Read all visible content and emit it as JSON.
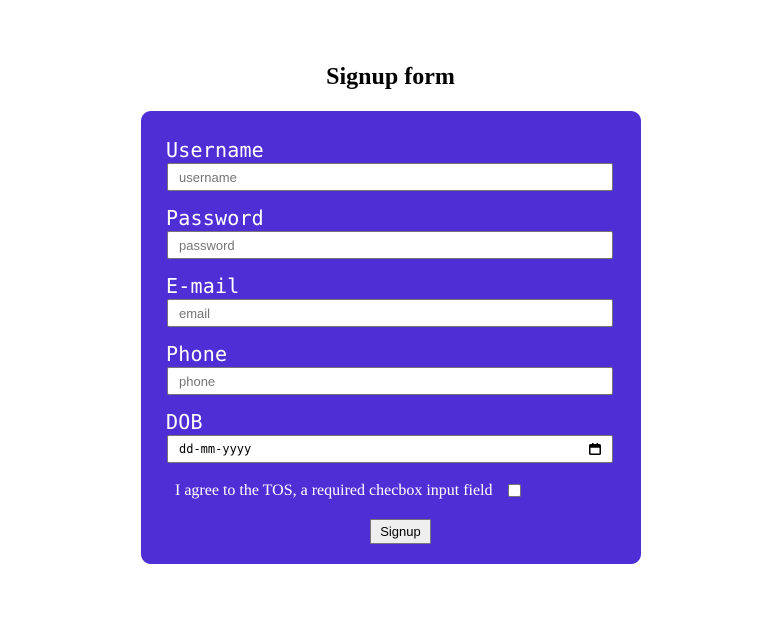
{
  "page": {
    "title": "Signup form"
  },
  "form": {
    "background_color": "#4e2fd6",
    "fields": [
      {
        "label": "Username",
        "placeholder": "username",
        "value": ""
      },
      {
        "label": "Password",
        "placeholder": "password",
        "value": ""
      },
      {
        "label": "E-mail",
        "placeholder": "email",
        "value": ""
      },
      {
        "label": "Phone",
        "placeholder": "phone",
        "value": ""
      }
    ],
    "dob": {
      "label": "DOB",
      "placeholder": "dd-mm-yyyy"
    },
    "tos": {
      "label": "I agree to the TOS, a required checbox input field",
      "checked": false
    },
    "submit_label": "Signup"
  }
}
